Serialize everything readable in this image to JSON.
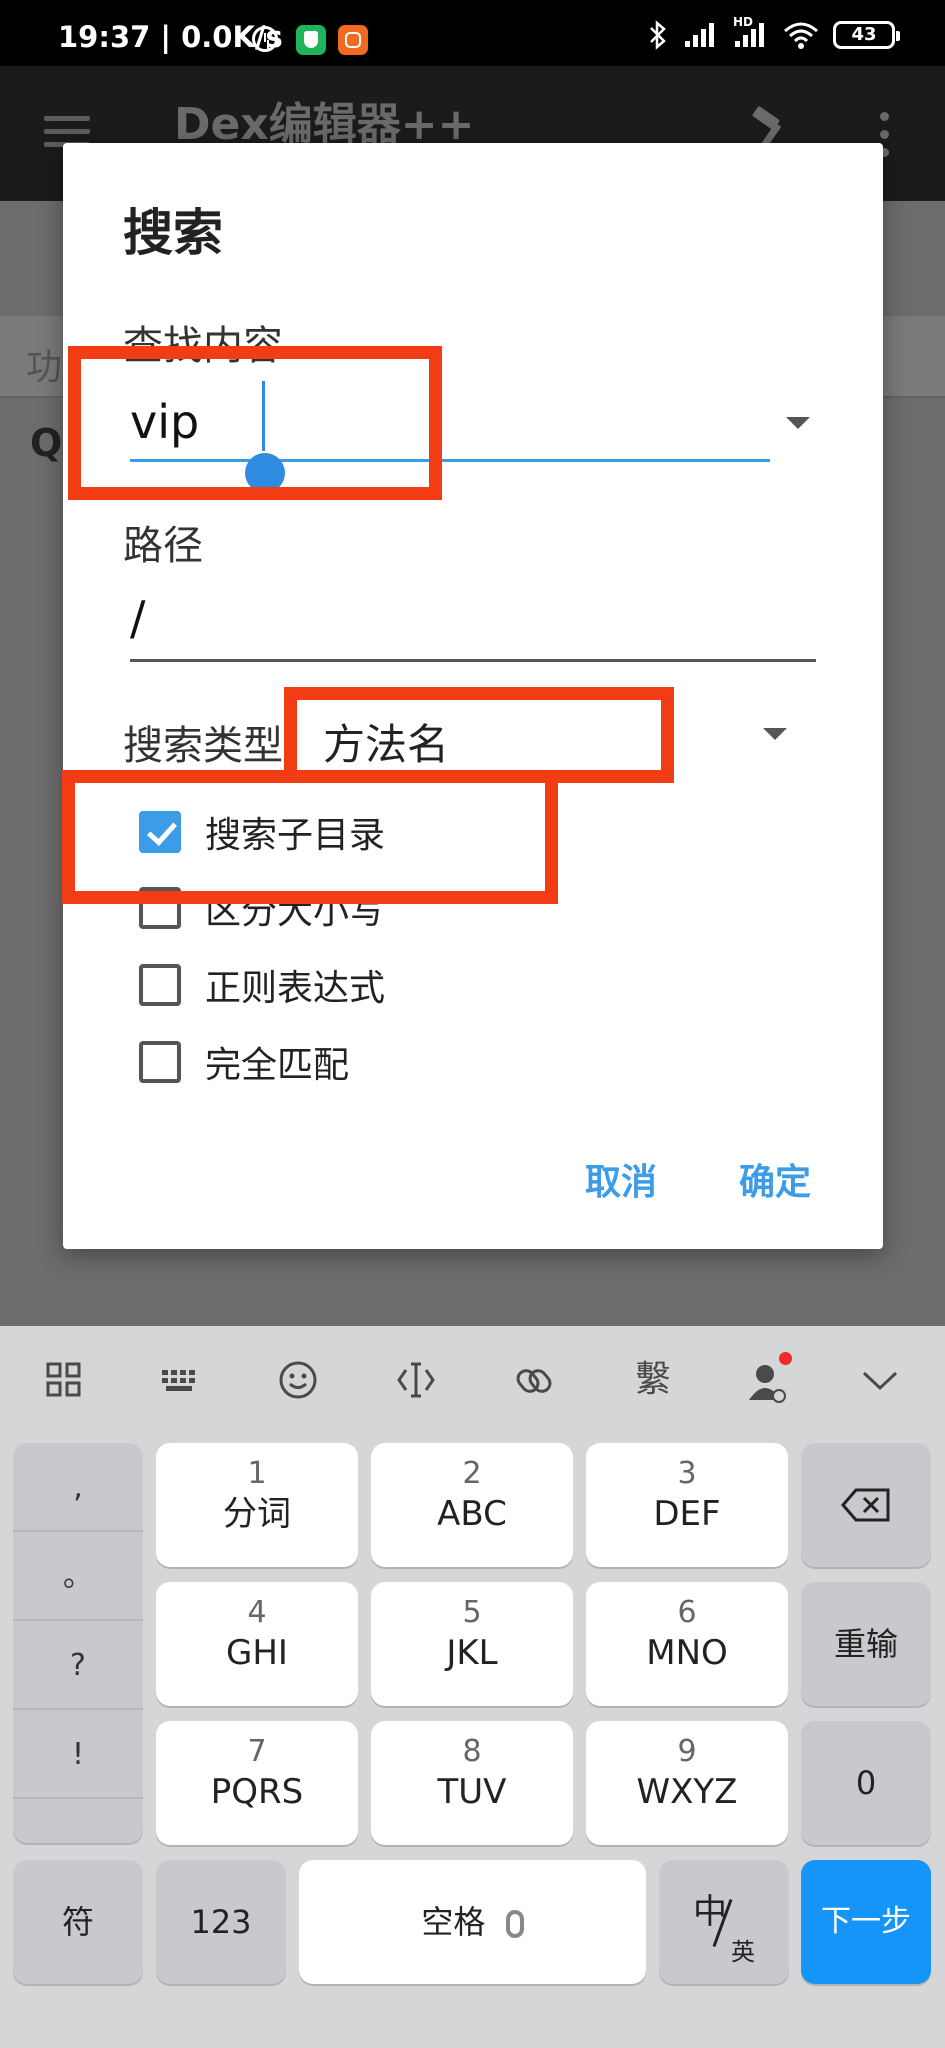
{
  "status_bar": {
    "time_speed": "19:37 | 0.0K/s",
    "network_tag": "HD",
    "battery": "43"
  },
  "app": {
    "title": "Dex编辑器++",
    "strip_text": "功",
    "search_glyph": "Q"
  },
  "dialog": {
    "title": "搜索",
    "find_label": "查找内容",
    "find_value": "vip",
    "path_label": "路径",
    "path_value": "/",
    "type_label": "搜索类型",
    "type_value": "方法名",
    "options": [
      {
        "label": "搜索子目录",
        "checked": true
      },
      {
        "label": "区分大小写",
        "checked": false
      },
      {
        "label": "正则表达式",
        "checked": false
      },
      {
        "label": "完全匹配",
        "checked": false
      }
    ],
    "cancel": "取消",
    "confirm": "确定"
  },
  "keyboard": {
    "toolbar_icons": [
      "grid-icon",
      "keyboard-icon",
      "emoji-icon",
      "cursor-icon",
      "clipboard-link-icon",
      "font-icon",
      "avatar-icon",
      "collapse-icon"
    ],
    "font_glyph": "繫",
    "punct": [
      ",",
      "。",
      "?",
      "!"
    ],
    "keys": [
      {
        "num": "1",
        "letters": "分词"
      },
      {
        "num": "2",
        "letters": "ABC"
      },
      {
        "num": "3",
        "letters": "DEF"
      },
      {
        "num": "4",
        "letters": "GHI"
      },
      {
        "num": "5",
        "letters": "JKL"
      },
      {
        "num": "6",
        "letters": "MNO"
      },
      {
        "num": "7",
        "letters": "PQRS"
      },
      {
        "num": "8",
        "letters": "TUV"
      },
      {
        "num": "9",
        "letters": "WXYZ"
      }
    ],
    "reenter": "重输",
    "zero": "0",
    "symbols": "符",
    "numbers": "123",
    "space": "空格",
    "lang_main": "中",
    "lang_sub": "英",
    "next": "下一步",
    "colors": {
      "accent": "#1495f7",
      "checkbox": "#3d9ce8",
      "annotation": "#f23c13"
    }
  }
}
